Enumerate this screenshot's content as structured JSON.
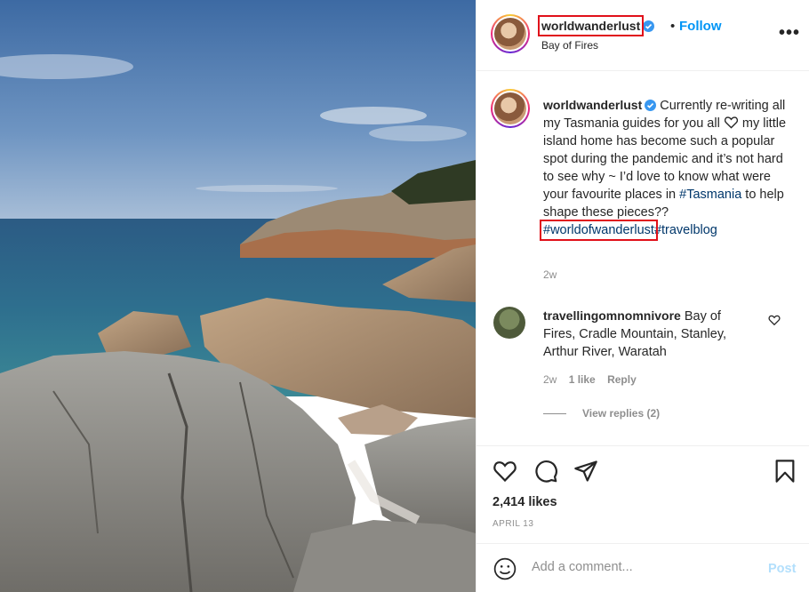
{
  "post": {
    "username": "worldwanderlust",
    "location": "Bay of Fires",
    "follow_label": "Follow",
    "dot": "•",
    "more_label": "•••"
  },
  "caption": {
    "username": "worldwanderlust",
    "text_1": "Currently re-writing all my Tasmania guides for you all",
    "text_2": "my little island home has become such a popular spot during the pandemic and it’s not hard to see why ~ I’d love to know what were your favourite places in",
    "hashtag_1": "#Tasmania",
    "text_3": "to help shape these pieces??",
    "hashtag_2": "#worldofwanderlust",
    "hashtag_3": "#travelblog",
    "time": "2w"
  },
  "comment": {
    "username": "travellingomnomnivore",
    "text": "Bay of Fires, Cradle Mountain, Stanley, Arthur River, Waratah",
    "time": "2w",
    "likes": "1 like",
    "reply_label": "Reply",
    "view_replies": "View replies (2)"
  },
  "actions": {
    "likes": "2,414 likes",
    "date": "APRIL 13"
  },
  "add_comment": {
    "placeholder": "Add a comment...",
    "post_label": "Post"
  },
  "colors": {
    "link": "#0095f6",
    "hashtag": "#00376b",
    "highlight_box": "#e0101a"
  },
  "icons": [
    "verified-badge-icon",
    "heart-icon",
    "comment-icon",
    "share-icon",
    "bookmark-icon",
    "emoji-icon",
    "more-options-icon"
  ]
}
